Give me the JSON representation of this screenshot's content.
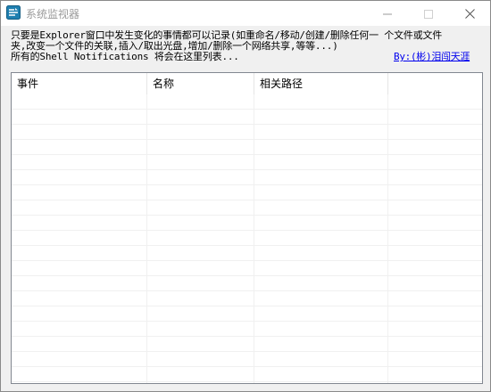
{
  "window": {
    "title": "系统监视器",
    "min_label": "minimize",
    "max_label": "maximize",
    "close_label": "close"
  },
  "description": {
    "line1": "只要是Explorer窗口中发生变化的事情都可以记录(如重命名/移动/创建/删除任何一 个文件或文件",
    "line2": "夹,改变一个文件的关联,插入/取出光盘,增加/删除一个网络共享,等等...)",
    "line3": "所有的Shell Notifications 将会在这里列表..."
  },
  "author_link": "By:(彬)泪闯天涯",
  "list": {
    "columns": [
      "事件",
      "名称",
      "相关路径",
      ""
    ],
    "rows": []
  },
  "colors": {
    "link": "#0000ee",
    "title_text": "#9a9a9a",
    "window_bg": "#f0f0f0",
    "grid_line": "#f0f0f0",
    "icon_accent": "#1e7fb0"
  },
  "icons": {
    "app": "app-icon",
    "minimize": "minimize-icon",
    "maximize": "maximize-icon",
    "close": "close-icon"
  }
}
